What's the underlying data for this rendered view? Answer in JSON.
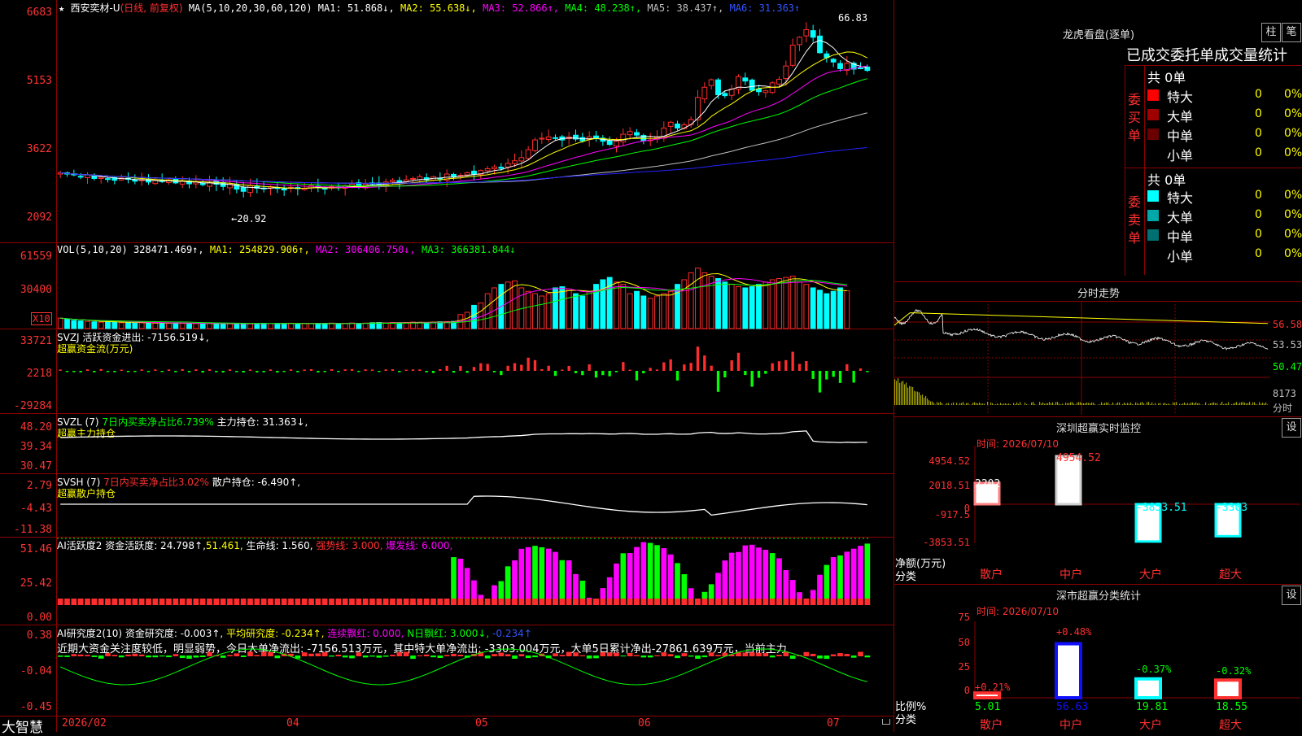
{
  "colors": {
    "up": "#ff2d2d",
    "down": "#00ffff",
    "ma1": "#ffffff",
    "ma2": "#ffff00",
    "ma3": "#ff00ff",
    "ma4": "#00ff00",
    "ma5": "#c0c0c0",
    "ma6": "#2222ff"
  },
  "header": {
    "star": "★",
    "name": "西安奕材-U",
    "mode": "(日线, 前复权)",
    "ma_label": "MA(5,10,20,30,60,120)",
    "ma1": "MA1: 51.868↓,",
    "ma2": "MA2: 55.638↓,",
    "ma3": "MA3: 52.866↑,",
    "ma4": "MA4: 48.238↑,",
    "ma5": "MA5: 38.437↑,",
    "ma6": "MA6: 31.363↑"
  },
  "price_axis": [
    "6683",
    "5153",
    "3622",
    "2092"
  ],
  "price_marks": {
    "high": "66.83",
    "low": "20.92"
  },
  "vol": {
    "title": "VOL(5,10,20)",
    "v": "328471.469↑,",
    "ma1": "MA1: 254829.906↑,",
    "ma2": "MA2: 306406.750↓,",
    "ma3": "MA3: 366381.844↓",
    "axis": [
      "61559",
      "30400"
    ],
    "unit": "X10"
  },
  "svzj": {
    "title": "SVZJ  活跃资金进出: -7156.519↓,",
    "sub": "超赢资金流(万元)",
    "axis": [
      "33721",
      "2218",
      "-29284"
    ]
  },
  "svzl": {
    "title_a": "SVZL (7)",
    "title_b": "7日内买卖净占比6.739%",
    "title_c": "主力持仓: 31.363↓,",
    "sub": "超赢主力持仓",
    "axis": [
      "48.20",
      "39.34",
      "30.47"
    ]
  },
  "svsh": {
    "title_a": "SVSH (7)",
    "title_b": "7日内买卖净占比3.02%",
    "title_c": "散户持仓: -6.490↑,",
    "sub": "超赢散户持仓",
    "axis": [
      "2.79",
      "-4.43",
      "-11.38"
    ]
  },
  "ai1": {
    "title": "AI活跃度2 资金活跃度: 24.798↑,",
    "v2": "51.461,",
    "v3": "生命线: 1.560,",
    "v4": "强势线: 3.000,",
    "v5": "爆发线: 6.000,",
    "axis": [
      "51.46",
      "25.42",
      "0.00"
    ]
  },
  "ai2": {
    "title": "AI研究度2(10) 资金研究度: -0.003↑,",
    "v2": "平均研究度: -0.234↑,",
    "v3": "连续飘红: 0.000,",
    "v4": "N日飘红: 3.000↓,",
    "v5": "-0.234↑",
    "axis": [
      "0.38",
      "-0.04",
      "-0.45"
    ],
    "comment": "近期大资金关注度较低，明显弱势，今日大单净流出: -7156.513万元，其中特大单净流出: -3303.004万元，大单5日累计净出-27861.639万元，当前主力"
  },
  "date_axis": [
    "2026/02",
    "04",
    "05",
    "06",
    "07"
  ],
  "logo": "大智慧",
  "right": {
    "lhb_title": "龙虎看盘(逐单)",
    "btn1": "柱",
    "btn2": "笔",
    "tabs": "已成交委托单成交量统计",
    "buy_label": "委买单",
    "sell_label": "委卖单",
    "buy_total": "共 0单",
    "sell_total": "共 0单",
    "buy_rows": [
      {
        "name": "特大",
        "v": "0",
        "p": "0%",
        "color": "#ff0000"
      },
      {
        "name": "大单",
        "v": "0",
        "p": "0%",
        "color": "#a00000"
      },
      {
        "name": "中单",
        "v": "0",
        "p": "0%",
        "color": "#6a0000"
      },
      {
        "name": "小单",
        "v": "0",
        "p": "0%",
        "color": ""
      }
    ],
    "sell_rows": [
      {
        "name": "特大",
        "v": "0",
        "p": "0%",
        "color": "#00ffff"
      },
      {
        "name": "大单",
        "v": "0",
        "p": "0%",
        "color": "#00a8a8"
      },
      {
        "name": "中单",
        "v": "0",
        "p": "0%",
        "color": "#007070"
      },
      {
        "name": "小单",
        "v": "0",
        "p": "0%",
        "color": ""
      }
    ],
    "intraday_title": "分时走势",
    "intraday_axis": [
      "56.58",
      "53.53",
      "50.47"
    ],
    "intraday_vol": "8173",
    "intraday_unit": "分时",
    "sz_title": "深圳超赢实时监控",
    "sz_btn": "设",
    "sz_time": "时间: 2026/07/10",
    "sz_axis": [
      "4954.52",
      "2018.51",
      "0",
      "-917.5",
      "-3853.51"
    ],
    "sz_ylabel": "净额(万元)",
    "sz_xlabel": "分类",
    "sz_cats": [
      "散户",
      "中户",
      "大户",
      "超大"
    ],
    "sz_vals": [
      "2202",
      "4954.52",
      "-3853.51",
      "-3303"
    ],
    "cls_title": "深市超赢分类统计",
    "cls_btn": "设",
    "cls_time": "时间: 2026/07/10",
    "cls_axis": [
      "75",
      "50",
      "25",
      "0"
    ],
    "cls_ylabel": "比例%",
    "cls_xlabel": "分类",
    "cls_pct": [
      "+0.21%",
      "+0.48%",
      "-0.37%",
      "-0.32%"
    ],
    "cls_vals": [
      "5.01",
      "56.63",
      "19.81",
      "18.55"
    ],
    "cls_cats": [
      "散户",
      "中户",
      "大户",
      "超大"
    ]
  },
  "chart_data": {
    "type": "candlestick",
    "price_range": [
      20.92,
      66.83
    ],
    "closes": [
      31.5,
      31.2,
      31.0,
      30.6,
      31.0,
      30.2,
      30.5,
      30.1,
      29.8,
      30.3,
      30.0,
      29.6,
      29.9,
      29.4,
      29.8,
      29.5,
      29.9,
      29.2,
      29.6,
      29.0,
      29.4,
      28.8,
      29.3,
      28.9,
      28.4,
      28.9,
      27.8,
      27.3,
      28.6,
      28.0,
      27.9,
      28.3,
      28.1,
      27.6,
      28.2,
      27.9,
      28.0,
      28.6,
      28.3,
      27.8,
      28.4,
      28.1,
      28.6,
      28.9,
      28.3,
      28.9,
      29.2,
      28.8,
      29.4,
      29.8,
      29.3,
      29.9,
      30.2,
      30.6,
      29.9,
      30.6,
      30.2,
      31.2,
      30.6,
      30.9,
      31.5,
      31.2,
      32.0,
      32.4,
      32.8,
      32.5,
      33.6,
      34.2,
      34.9,
      36.7,
      38.9,
      39.3,
      39.6,
      39.4,
      38.9,
      39.6,
      39.1,
      38.7,
      39.6,
      39.2,
      38.6,
      37.9,
      38.6,
      40.2,
      40.8,
      40.0,
      38.7,
      38.9,
      39.5,
      41.6,
      42.9,
      41.6,
      42.3,
      43.5,
      48.5,
      50.8,
      52.5,
      49.1,
      48.9,
      50.4,
      53.2,
      52.2,
      50.1,
      49.8,
      50.0,
      51.8,
      52.6,
      55.6,
      60.3,
      62.1,
      63.8,
      62.1,
      58.6,
      57.5,
      56.5,
      55.0,
      56.2,
      54.9,
      55.1,
      54.6
    ],
    "volume_x10": [
      9000,
      8000,
      7000,
      6500,
      6200,
      5800,
      5500,
      6000,
      5600,
      5000,
      5200,
      4800,
      5000,
      4800,
      4600,
      4700,
      4500,
      4800,
      4500,
      4300,
      4400,
      4200,
      4500,
      4000,
      4200,
      4100,
      4200,
      4000,
      4100,
      4300,
      4500,
      4200,
      4400,
      4300,
      4600,
      4200,
      4500,
      4400,
      4300,
      4500,
      4700,
      4400,
      4500,
      4800,
      4500,
      4700,
      5000,
      5200,
      4800,
      5200,
      5000,
      5300,
      5600,
      5400,
      5200,
      5600,
      5800,
      6000,
      6200,
      12000,
      14000,
      20000,
      22000,
      30000,
      35000,
      38000,
      40000,
      41000,
      35000,
      32000,
      30000,
      28000,
      30000,
      35000,
      36000,
      34000,
      30000,
      28000,
      32000,
      38000,
      42000,
      44000,
      40000,
      38000,
      30000,
      32000,
      28000,
      26000,
      28000,
      30000,
      32000,
      38000,
      42000,
      48000,
      52000,
      48000,
      45000,
      43000,
      40000,
      38000,
      36000,
      35000,
      36000,
      38000,
      40000,
      42000,
      43000,
      44000,
      45000,
      40000,
      38000,
      35000,
      33000,
      30000,
      32000,
      35000,
      32500
    ]
  }
}
